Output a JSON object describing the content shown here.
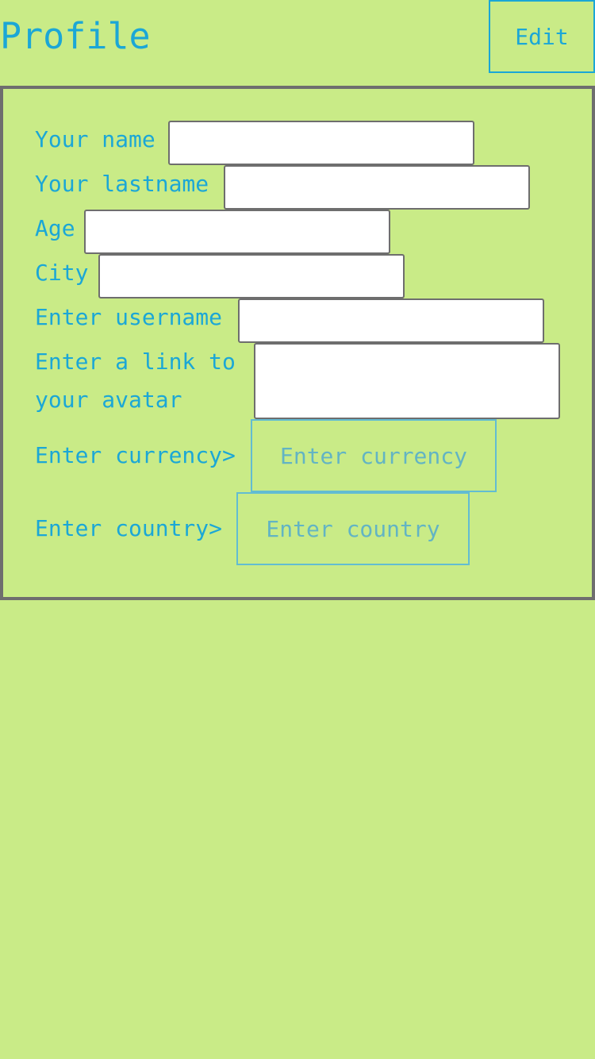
{
  "header": {
    "title": "Profile",
    "edit_label": "Edit"
  },
  "form": {
    "name_label": "Your name",
    "name_value": "",
    "lastname_label": "Your lastname",
    "lastname_value": "",
    "age_label": "Age",
    "age_value": "",
    "city_label": "City",
    "city_value": "",
    "username_label": "Enter username",
    "username_value": "",
    "avatar_label": "Enter a link to your avatar",
    "avatar_value": "",
    "currency_label": "Enter currency>",
    "currency_button": "Enter currency",
    "country_label": "Enter country>",
    "country_button": "Enter country"
  },
  "colors": {
    "background": "#c9eb87",
    "accent": "#1ba7d6",
    "border": "#6e6e6e"
  }
}
